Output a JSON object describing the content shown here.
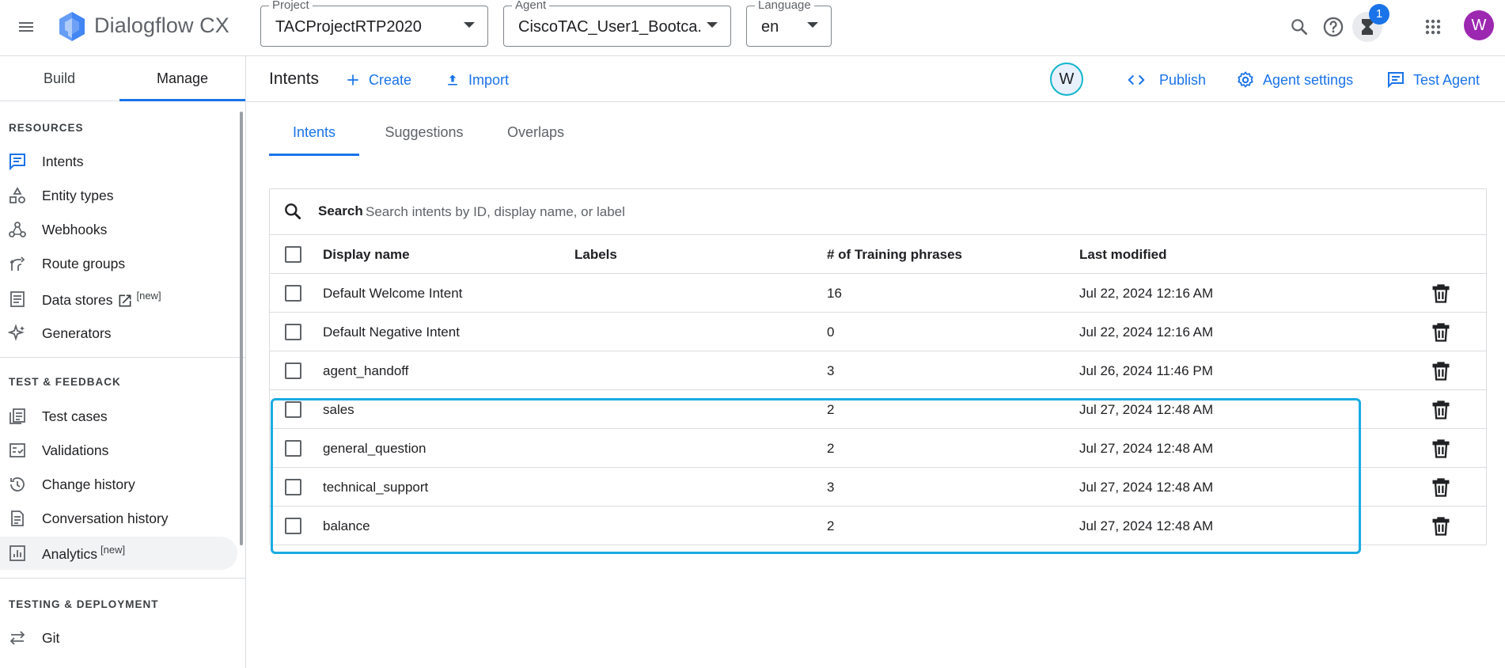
{
  "app": {
    "title": "Dialogflow CX"
  },
  "topbar": {
    "project": {
      "label": "Project",
      "value": "TACProjectRTP2020"
    },
    "agent": {
      "label": "Agent",
      "value": "CiscoTAC_User1_Bootca..."
    },
    "language": {
      "label": "Language",
      "value": "en"
    },
    "notification_count": "1",
    "user_initial": "W",
    "icons": [
      "menu-icon",
      "dialogflow-logo",
      "search-icon",
      "help-icon",
      "hourglass-icon",
      "apps-grid-icon"
    ]
  },
  "sidebar": {
    "tabs": [
      {
        "label": "Build"
      },
      {
        "label": "Manage",
        "active": true
      }
    ],
    "sections": [
      {
        "title": "RESOURCES",
        "items": [
          {
            "label": "Intents",
            "icon": "intents-icon",
            "selected_style": "blue"
          },
          {
            "label": "Entity types",
            "icon": "entity-types-icon"
          },
          {
            "label": "Webhooks",
            "icon": "webhooks-icon"
          },
          {
            "label": "Route groups",
            "icon": "route-groups-icon"
          },
          {
            "label": "Data stores",
            "icon": "data-stores-icon",
            "sup": "[new]"
          },
          {
            "label": "Generators",
            "icon": "generators-icon"
          }
        ]
      },
      {
        "title": "TEST & FEEDBACK",
        "items": [
          {
            "label": "Test cases",
            "icon": "test-cases-icon"
          },
          {
            "label": "Validations",
            "icon": "validations-icon"
          },
          {
            "label": "Change history",
            "icon": "history-icon"
          },
          {
            "label": "Conversation history",
            "icon": "conversation-history-icon"
          },
          {
            "label": "Analytics",
            "icon": "analytics-icon",
            "sup": "[new]"
          }
        ]
      },
      {
        "title": "TESTING & DEPLOYMENT",
        "items": [
          {
            "label": "Git",
            "icon": "git-icon"
          }
        ]
      }
    ]
  },
  "header": {
    "title": "Intents",
    "create_label": "Create",
    "import_label": "Import",
    "avatar_initial": "W",
    "publish_label": "Publish",
    "agent_settings_label": "Agent settings",
    "test_agent_label": "Test Agent"
  },
  "content_tabs": [
    {
      "label": "Intents",
      "active": true
    },
    {
      "label": "Suggestions"
    },
    {
      "label": "Overlaps"
    }
  ],
  "search": {
    "label": "Search",
    "placeholder": "Search intents by ID, display name, or label"
  },
  "table": {
    "columns": {
      "display_name": "Display name",
      "labels": "Labels",
      "training_phrases": "# of Training phrases",
      "last_modified": "Last modified"
    },
    "rows": [
      {
        "name": "Default Welcome Intent",
        "labels": "",
        "phrases": "16",
        "modified": "Jul 22, 2024 12:16 AM"
      },
      {
        "name": "Default Negative Intent",
        "labels": "",
        "phrases": "0",
        "modified": "Jul 22, 2024 12:16 AM"
      },
      {
        "name": "agent_handoff",
        "labels": "",
        "phrases": "3",
        "modified": "Jul 26, 2024 11:46 PM"
      },
      {
        "name": "sales",
        "labels": "",
        "phrases": "2",
        "modified": "Jul 27, 2024 12:48 AM"
      },
      {
        "name": "general_question",
        "labels": "",
        "phrases": "2",
        "modified": "Jul 27, 2024 12:48 AM"
      },
      {
        "name": "technical_support",
        "labels": "",
        "phrases": "3",
        "modified": "Jul 27, 2024 12:48 AM"
      },
      {
        "name": "balance",
        "labels": "",
        "phrases": "2",
        "modified": "Jul 27, 2024 12:48 AM"
      }
    ]
  },
  "colors": {
    "accent": "#1a73e8",
    "highlight_box": "#1aabe3",
    "user_avatar": "#9c27b0"
  }
}
